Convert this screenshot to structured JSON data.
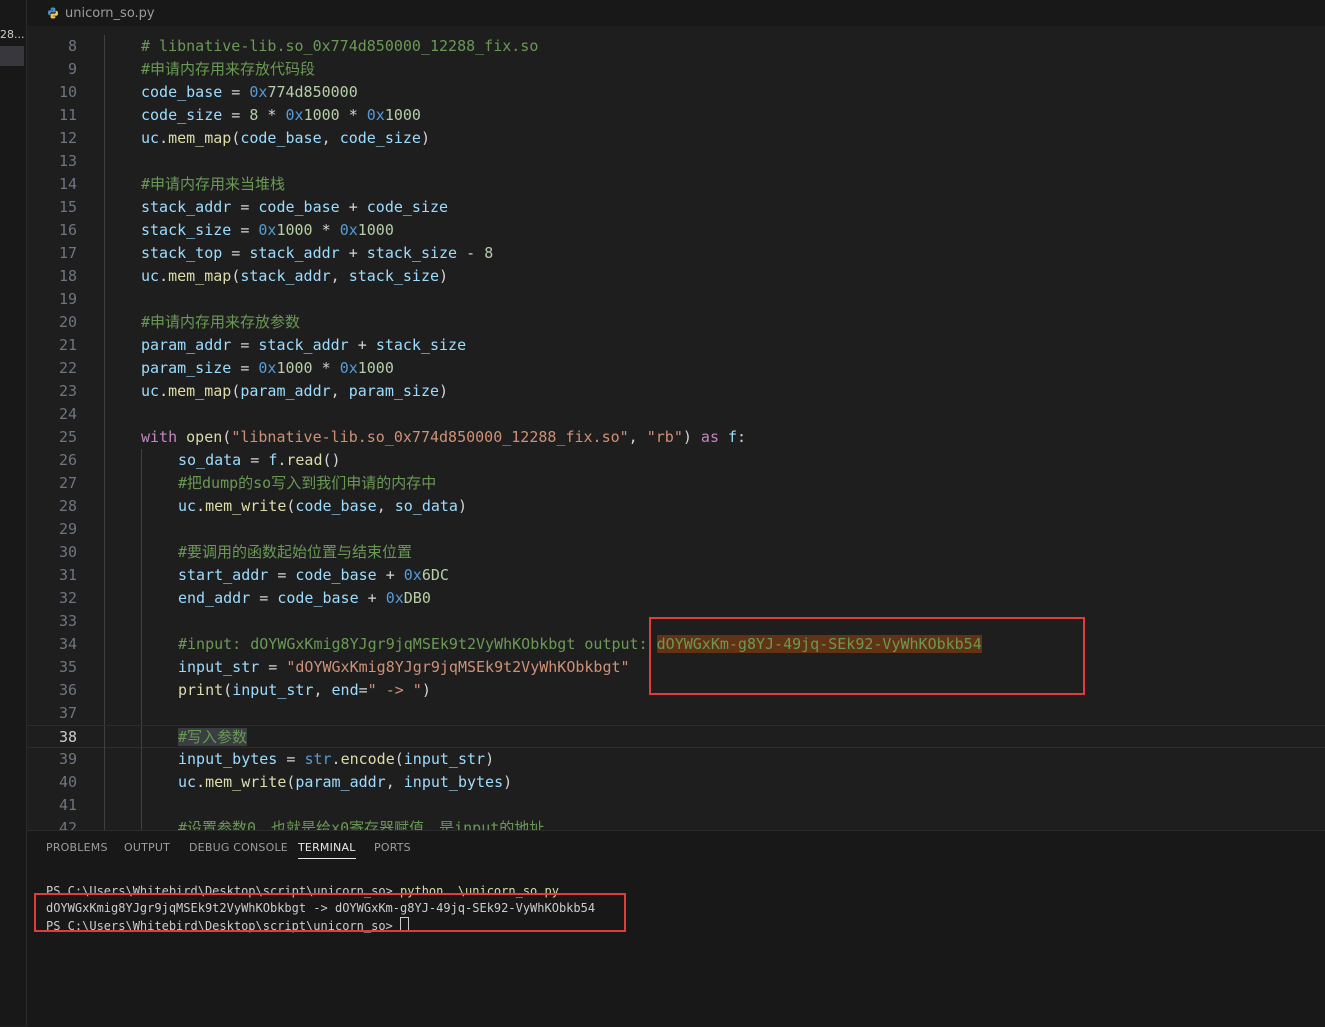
{
  "sidebar": {
    "label": "28..."
  },
  "tab": {
    "filename": "unicorn_so.py"
  },
  "code_lines": [
    {
      "n": "8",
      "indent": 1,
      "tokens": [
        [
          "c-cm",
          "# libnative-lib.so_0x774d850000_12288_fix.so"
        ]
      ]
    },
    {
      "n": "9",
      "indent": 1,
      "tokens": [
        [
          "c-cm",
          "#申请内存用来存放代码段"
        ]
      ]
    },
    {
      "n": "10",
      "indent": 1,
      "tokens": [
        [
          "c-var",
          "code_base"
        ],
        [
          "c-op",
          " = "
        ],
        [
          "c-hex",
          "0x"
        ],
        [
          "c-num",
          "774d850000"
        ]
      ]
    },
    {
      "n": "11",
      "indent": 1,
      "tokens": [
        [
          "c-var",
          "code_size"
        ],
        [
          "c-op",
          " = "
        ],
        [
          "c-num",
          "8"
        ],
        [
          "c-op",
          " * "
        ],
        [
          "c-hex",
          "0x"
        ],
        [
          "c-num",
          "1000"
        ],
        [
          "c-op",
          " * "
        ],
        [
          "c-hex",
          "0x"
        ],
        [
          "c-num",
          "1000"
        ]
      ]
    },
    {
      "n": "12",
      "indent": 1,
      "tokens": [
        [
          "c-var",
          "uc"
        ],
        [
          "c-op",
          "."
        ],
        [
          "c-fn",
          "mem_map"
        ],
        [
          "c-op",
          "("
        ],
        [
          "c-var",
          "code_base"
        ],
        [
          "c-op",
          ", "
        ],
        [
          "c-var",
          "code_size"
        ],
        [
          "c-op",
          ")"
        ]
      ]
    },
    {
      "n": "13",
      "indent": 1,
      "tokens": []
    },
    {
      "n": "14",
      "indent": 1,
      "tokens": [
        [
          "c-cm",
          "#申请内存用来当堆栈"
        ]
      ]
    },
    {
      "n": "15",
      "indent": 1,
      "tokens": [
        [
          "c-var",
          "stack_addr"
        ],
        [
          "c-op",
          " = "
        ],
        [
          "c-var",
          "code_base"
        ],
        [
          "c-op",
          " + "
        ],
        [
          "c-var",
          "code_size"
        ]
      ]
    },
    {
      "n": "16",
      "indent": 1,
      "tokens": [
        [
          "c-var",
          "stack_size"
        ],
        [
          "c-op",
          " = "
        ],
        [
          "c-hex",
          "0x"
        ],
        [
          "c-num",
          "1000"
        ],
        [
          "c-op",
          " * "
        ],
        [
          "c-hex",
          "0x"
        ],
        [
          "c-num",
          "1000"
        ]
      ]
    },
    {
      "n": "17",
      "indent": 1,
      "tokens": [
        [
          "c-var",
          "stack_top"
        ],
        [
          "c-op",
          " = "
        ],
        [
          "c-var",
          "stack_addr"
        ],
        [
          "c-op",
          " + "
        ],
        [
          "c-var",
          "stack_size"
        ],
        [
          "c-op",
          " - "
        ],
        [
          "c-num",
          "8"
        ]
      ]
    },
    {
      "n": "18",
      "indent": 1,
      "tokens": [
        [
          "c-var",
          "uc"
        ],
        [
          "c-op",
          "."
        ],
        [
          "c-fn",
          "mem_map"
        ],
        [
          "c-op",
          "("
        ],
        [
          "c-var",
          "stack_addr"
        ],
        [
          "c-op",
          ", "
        ],
        [
          "c-var",
          "stack_size"
        ],
        [
          "c-op",
          ")"
        ]
      ]
    },
    {
      "n": "19",
      "indent": 1,
      "tokens": []
    },
    {
      "n": "20",
      "indent": 1,
      "tokens": [
        [
          "c-cm",
          "#申请内存用来存放参数"
        ]
      ]
    },
    {
      "n": "21",
      "indent": 1,
      "tokens": [
        [
          "c-var",
          "param_addr"
        ],
        [
          "c-op",
          " = "
        ],
        [
          "c-var",
          "stack_addr"
        ],
        [
          "c-op",
          " + "
        ],
        [
          "c-var",
          "stack_size"
        ]
      ]
    },
    {
      "n": "22",
      "indent": 1,
      "tokens": [
        [
          "c-var",
          "param_size"
        ],
        [
          "c-op",
          " = "
        ],
        [
          "c-hex",
          "0x"
        ],
        [
          "c-num",
          "1000"
        ],
        [
          "c-op",
          " * "
        ],
        [
          "c-hex",
          "0x"
        ],
        [
          "c-num",
          "1000"
        ]
      ]
    },
    {
      "n": "23",
      "indent": 1,
      "tokens": [
        [
          "c-var",
          "uc"
        ],
        [
          "c-op",
          "."
        ],
        [
          "c-fn",
          "mem_map"
        ],
        [
          "c-op",
          "("
        ],
        [
          "c-var",
          "param_addr"
        ],
        [
          "c-op",
          ", "
        ],
        [
          "c-var",
          "param_size"
        ],
        [
          "c-op",
          ")"
        ]
      ]
    },
    {
      "n": "24",
      "indent": 1,
      "tokens": []
    },
    {
      "n": "25",
      "indent": 1,
      "tokens": [
        [
          "c-kw",
          "with"
        ],
        [
          "c-op",
          " "
        ],
        [
          "c-fn",
          "open"
        ],
        [
          "c-op",
          "("
        ],
        [
          "c-str",
          "\"libnative-lib.so_0x774d850000_12288_fix.so\""
        ],
        [
          "c-op",
          ", "
        ],
        [
          "c-str",
          "\"rb\""
        ],
        [
          "c-op",
          ") "
        ],
        [
          "c-kw",
          "as"
        ],
        [
          "c-op",
          " "
        ],
        [
          "c-var",
          "f"
        ],
        [
          "c-op",
          ":"
        ]
      ]
    },
    {
      "n": "26",
      "indent": 2,
      "tokens": [
        [
          "c-var",
          "so_data"
        ],
        [
          "c-op",
          " = "
        ],
        [
          "c-var",
          "f"
        ],
        [
          "c-op",
          "."
        ],
        [
          "c-fn",
          "read"
        ],
        [
          "c-op",
          "()"
        ]
      ]
    },
    {
      "n": "27",
      "indent": 2,
      "tokens": [
        [
          "c-cm",
          "#把dump的so写入到我们申请的内存中"
        ]
      ]
    },
    {
      "n": "28",
      "indent": 2,
      "tokens": [
        [
          "c-var",
          "uc"
        ],
        [
          "c-op",
          "."
        ],
        [
          "c-fn",
          "mem_write"
        ],
        [
          "c-op",
          "("
        ],
        [
          "c-var",
          "code_base"
        ],
        [
          "c-op",
          ", "
        ],
        [
          "c-var",
          "so_data"
        ],
        [
          "c-op",
          ")"
        ]
      ]
    },
    {
      "n": "29",
      "indent": 2,
      "tokens": []
    },
    {
      "n": "30",
      "indent": 2,
      "tokens": [
        [
          "c-cm",
          "#要调用的函数起始位置与结束位置"
        ]
      ]
    },
    {
      "n": "31",
      "indent": 2,
      "tokens": [
        [
          "c-var",
          "start_addr"
        ],
        [
          "c-op",
          " = "
        ],
        [
          "c-var",
          "code_base"
        ],
        [
          "c-op",
          " + "
        ],
        [
          "c-hex",
          "0x"
        ],
        [
          "c-num",
          "6DC"
        ]
      ]
    },
    {
      "n": "32",
      "indent": 2,
      "tokens": [
        [
          "c-var",
          "end_addr"
        ],
        [
          "c-op",
          " = "
        ],
        [
          "c-var",
          "code_base"
        ],
        [
          "c-op",
          " + "
        ],
        [
          "c-hex",
          "0x"
        ],
        [
          "c-num",
          "DB0"
        ]
      ]
    },
    {
      "n": "33",
      "indent": 2,
      "tokens": []
    },
    {
      "n": "34",
      "indent": 2,
      "tokens": [
        [
          "c-cm",
          "#input: dOYWGxKmig8YJgr9jqMSEk9t2VyWhKObkbgt output: "
        ],
        [
          "c-cm hl-output",
          "dOYWGxKm-g8YJ-49jq-SEk92-VyWhKObkb54"
        ]
      ]
    },
    {
      "n": "35",
      "indent": 2,
      "tokens": [
        [
          "c-var",
          "input_str"
        ],
        [
          "c-op",
          " = "
        ],
        [
          "c-str",
          "\"dOYWGxKmig8YJgr9jqMSEk9t2VyWhKObkbgt\""
        ]
      ]
    },
    {
      "n": "36",
      "indent": 2,
      "tokens": [
        [
          "c-fn",
          "print"
        ],
        [
          "c-op",
          "("
        ],
        [
          "c-var",
          "input_str"
        ],
        [
          "c-op",
          ", "
        ],
        [
          "c-var",
          "end"
        ],
        [
          "c-op",
          "="
        ],
        [
          "c-str",
          "\" -> \""
        ],
        [
          "c-op",
          ")"
        ]
      ]
    },
    {
      "n": "37",
      "indent": 2,
      "tokens": []
    },
    {
      "n": "38",
      "indent": 2,
      "current": true,
      "tokens": [
        [
          "c-cm hl-word",
          "#写入参数"
        ]
      ]
    },
    {
      "n": "39",
      "indent": 2,
      "tokens": [
        [
          "c-var",
          "input_bytes"
        ],
        [
          "c-op",
          " = "
        ],
        [
          "c-kw2",
          "str"
        ],
        [
          "c-op",
          "."
        ],
        [
          "c-fn",
          "encode"
        ],
        [
          "c-op",
          "("
        ],
        [
          "c-var",
          "input_str"
        ],
        [
          "c-op",
          ")"
        ]
      ]
    },
    {
      "n": "40",
      "indent": 2,
      "tokens": [
        [
          "c-var",
          "uc"
        ],
        [
          "c-op",
          "."
        ],
        [
          "c-fn",
          "mem_write"
        ],
        [
          "c-op",
          "("
        ],
        [
          "c-var",
          "param_addr"
        ],
        [
          "c-op",
          ", "
        ],
        [
          "c-var",
          "input_bytes"
        ],
        [
          "c-op",
          ")"
        ]
      ]
    },
    {
      "n": "41",
      "indent": 2,
      "tokens": []
    },
    {
      "n": "42",
      "indent": 2,
      "tokens": [
        [
          "c-cm",
          "#设置参数0，也就是给x0寄存器赋值，是input的地址"
        ]
      ]
    }
  ],
  "panel": {
    "tabs": [
      "PROBLEMS",
      "OUTPUT",
      "DEBUG CONSOLE",
      "TERMINAL",
      "PORTS"
    ],
    "active_tab": "TERMINAL",
    "terminal": {
      "prompt1": "PS C:\\Users\\Whitebird\\Desktop\\script\\unicorn_so> ",
      "command": "python .\\unicorn_so.py",
      "output": "dOYWGxKmig8YJgr9jqMSEk9t2VyWhKObkbgt -> dOYWGxKm-g8YJ-49jq-SEk92-VyWhKObkb54",
      "prompt2": "PS C:\\Users\\Whitebird\\Desktop\\script\\unicorn_so> "
    }
  },
  "colors": {
    "highlight_box": "#e03c3c",
    "background": "#1e1e1e"
  }
}
